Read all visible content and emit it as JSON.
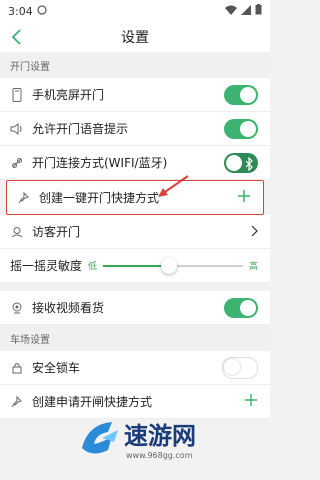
{
  "statusbar": {
    "time": "3:04"
  },
  "header": {
    "title": "设置"
  },
  "sections": {
    "door": "开门设置",
    "parking": "车场设置"
  },
  "rows": {
    "shake_screen_on": "手机亮屏开门",
    "voice_prompt": "允许开门语音提示",
    "connect_mode": "开门连接方式(WIFI/蓝牙)",
    "create_shortcut": "创建一键开门快捷方式",
    "visitor_open": "访客开门",
    "shake_sensitivity": "摇一摇灵敏度",
    "low": "低",
    "high": "高",
    "receive_video": "接收视频看货",
    "security_lock": "安全锁车",
    "create_apply_shortcut": "创建申请开闸快捷方式"
  },
  "controls": {
    "sensitivity_level": 0.47
  },
  "watermark": {
    "text": "速游网",
    "url": "www.968gg.com"
  },
  "colors": {
    "accent": "#3cb371",
    "highlight": "#d9413a"
  }
}
